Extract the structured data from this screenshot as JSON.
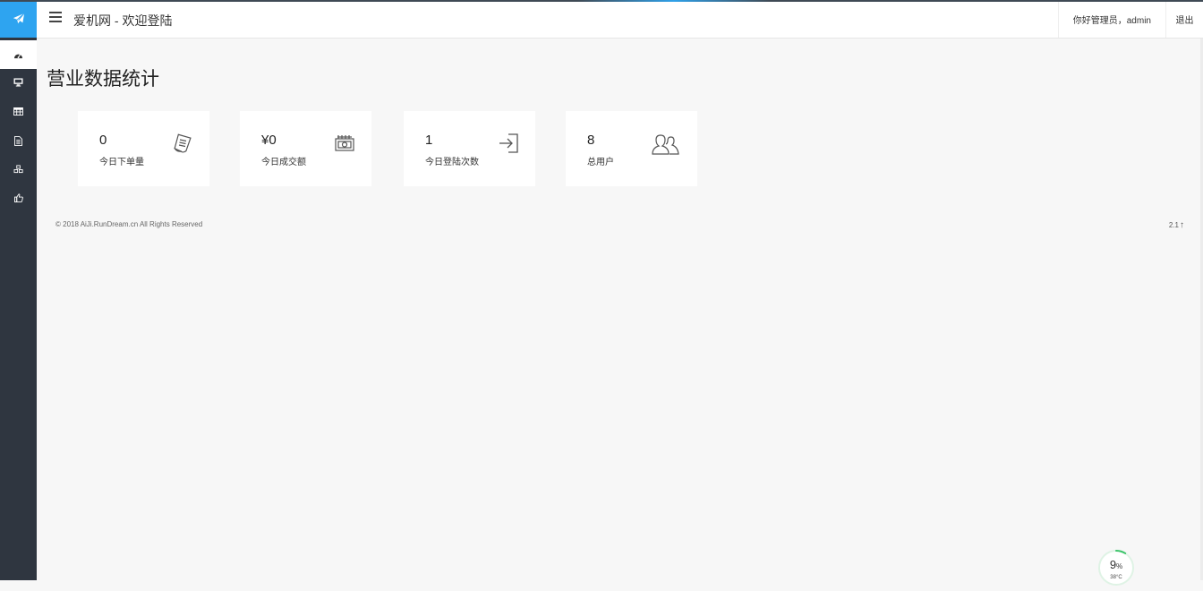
{
  "header": {
    "site_title": "爱机网 - 欢迎登陆",
    "greeting": "你好管理员，admin",
    "logout_label": "退出"
  },
  "sidebar": {
    "items": [
      {
        "icon": "dashboard-icon",
        "active": true
      },
      {
        "icon": "desktop-icon",
        "active": false
      },
      {
        "icon": "table-icon",
        "active": false
      },
      {
        "icon": "document-icon",
        "active": false
      },
      {
        "icon": "cubes-icon",
        "active": false
      },
      {
        "icon": "thumbs-up-icon",
        "active": false
      }
    ]
  },
  "main": {
    "title": "营业数据统计",
    "cards": [
      {
        "value": "0",
        "label": "今日下单量",
        "icon": "receipt-icon"
      },
      {
        "value": "¥0",
        "label": "今日成交额",
        "icon": "money-icon"
      },
      {
        "value": "1",
        "label": "今日登陆次数",
        "icon": "sign-in-icon"
      },
      {
        "value": "8",
        "label": "总用户",
        "icon": "users-icon"
      }
    ]
  },
  "footer": {
    "copyright": "© 2018 AiJi.RunDream.cn All Rights Reserved",
    "version": "2.1"
  },
  "gauge": {
    "value_number": "9",
    "value_unit": "%",
    "sub": "38°C",
    "percent": 9
  },
  "colors": {
    "sidebar_bg": "#2f3640",
    "logo_bg": "#2ea4f0",
    "page_bg": "#f7f7f7",
    "gauge_accent": "#3cc46a"
  }
}
